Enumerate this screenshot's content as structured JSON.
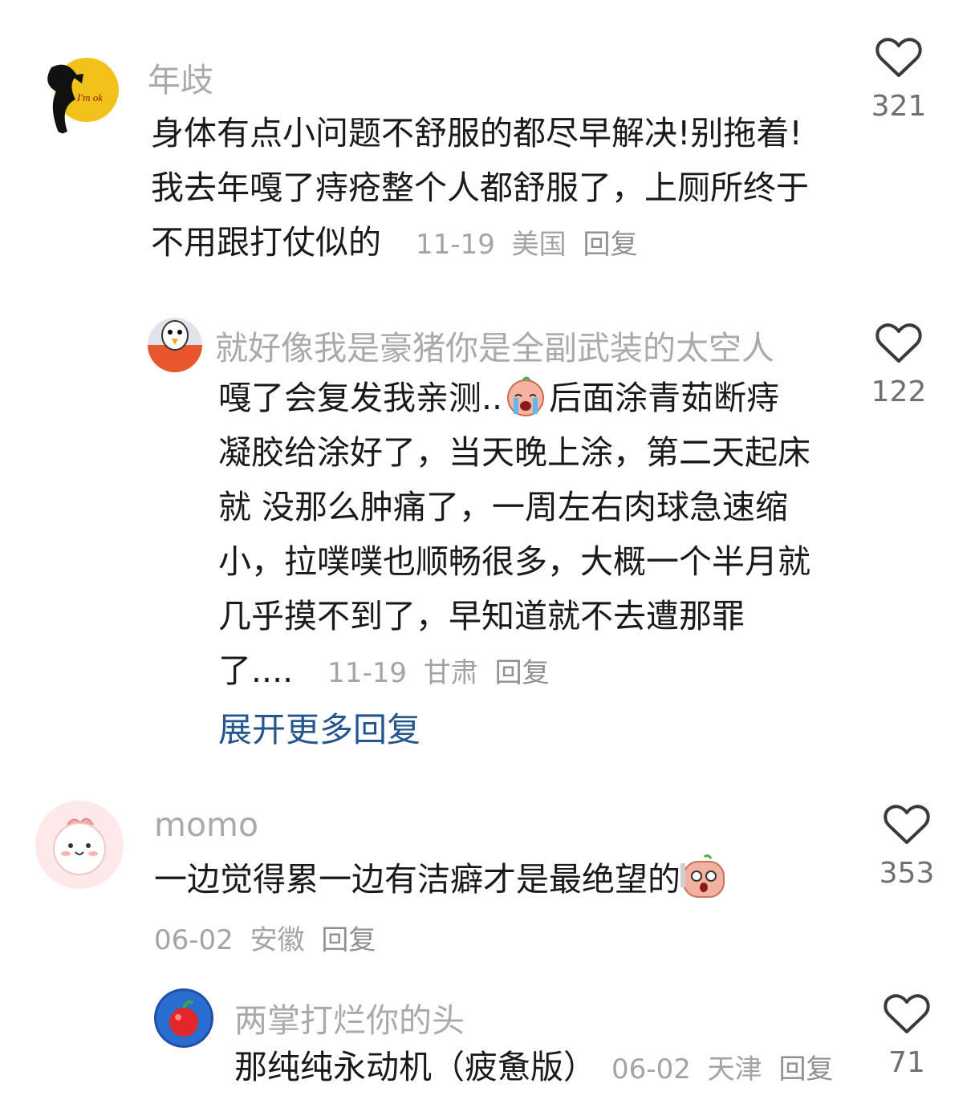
{
  "comments": [
    {
      "username": "年歧",
      "text": "身体有点小问题不舒服的都尽早解决!别拖着!我去年嘎了痔疮整个人都舒服了，上厕所终于不用跟打仗似的",
      "date": "11-19",
      "location": "美国",
      "reply_label": "回复",
      "likes": "321",
      "avatar_text": "I'm ok",
      "icons": {
        "like": "heart-outline-icon"
      }
    },
    {
      "username": "就好像我是豪猪你是全副武装的太空人",
      "text_before_emoji": "嘎了会复发我亲测..",
      "emoji": "crying-emoji",
      "text_after_emoji": "后面涂青茹断痔凝胶给涂好了，当天晚上涂，第二天起床就 没那么肿痛了，一周左右肉球急速缩小，拉噗噗也顺畅很多，大概一个半月就几乎摸不到了，早知道就不去遭那罪了....",
      "date": "11-19",
      "location": "甘肃",
      "reply_label": "回复",
      "likes": "122"
    },
    {
      "expand_label": "展开更多回复",
      "expand_color": "#24558f"
    },
    {
      "username": "momo",
      "text": "一边觉得累一边有洁癖才是最绝望的",
      "emoji": "shocked-emoji",
      "date": "06-02",
      "location": "安徽",
      "reply_label": "回复",
      "likes": "353"
    },
    {
      "username": "两掌打烂你的头",
      "text": "那纯纯永动机（疲惫版）",
      "date": "06-02",
      "location": "天津",
      "reply_label": "回复",
      "likes": "71"
    }
  ]
}
